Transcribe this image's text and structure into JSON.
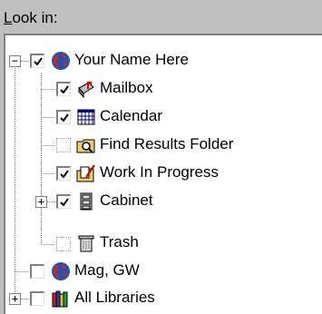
{
  "look_in_label": "Look in:",
  "tree": {
    "root": {
      "label": "Your Name Here",
      "expander": "−",
      "checked": true,
      "icon": "globe-icon"
    },
    "children": [
      {
        "label": "Mailbox",
        "checked": true,
        "icon": "mailbox-icon"
      },
      {
        "label": "Calendar",
        "checked": true,
        "icon": "calendar-icon"
      },
      {
        "label": "Find Results Folder",
        "checked": false,
        "icon": "find-results-folder-icon"
      },
      {
        "label": "Work In Progress",
        "checked": true,
        "icon": "work-in-progress-icon"
      },
      {
        "label": "Cabinet",
        "checked": true,
        "icon": "cabinet-icon",
        "expander": "+"
      },
      {
        "label": "Trash",
        "checked": false,
        "icon": "trash-icon"
      }
    ],
    "siblings": [
      {
        "label": "Mag, GW",
        "checked": false,
        "icon": "globe-icon"
      },
      {
        "label": "All Libraries",
        "checked": false,
        "icon": "libraries-icon",
        "expander": "+"
      }
    ]
  }
}
